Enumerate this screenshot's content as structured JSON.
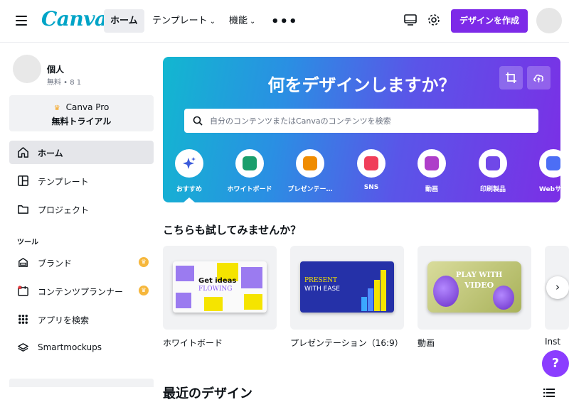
{
  "header": {
    "logo": "Canva",
    "nav": [
      "ホーム",
      "テンプレート",
      "機能"
    ],
    "create_button": "デザインを作成"
  },
  "sidebar": {
    "user": {
      "name": "個人",
      "meta": "無料 • 8 1"
    },
    "pro": {
      "title": "Canva Pro",
      "subtitle": "無料トライアル"
    },
    "items": [
      {
        "label": "ホーム",
        "icon": "home-icon",
        "active": true
      },
      {
        "label": "テンプレート",
        "icon": "template-icon"
      },
      {
        "label": "プロジェクト",
        "icon": "folder-icon"
      }
    ],
    "tools_label": "ツール",
    "tools": [
      {
        "label": "ブランド",
        "icon": "brand-icon",
        "pro": true
      },
      {
        "label": "コンテンツプランナー",
        "icon": "calendar-icon",
        "pro": true
      },
      {
        "label": "アプリを検索",
        "icon": "apps-grid-icon"
      },
      {
        "label": "Smartmockups",
        "icon": "layers-icon"
      }
    ]
  },
  "hero": {
    "title": "何をデザインしますか？",
    "search_placeholder": "自分のコンテンツまたはCanvaのコンテンツを検索",
    "categories": [
      {
        "label": "おすすめ",
        "icon": "sparkle-icon",
        "color": "#3b5bdb"
      },
      {
        "label": "ホワイトボード",
        "icon": "whiteboard-icon",
        "color": "#1a9e6b"
      },
      {
        "label": "プレゼンテー…",
        "icon": "presentation-icon",
        "color": "#f08c00"
      },
      {
        "label": "SNS",
        "icon": "heart-icon",
        "color": "#f03e5a"
      },
      {
        "label": "動画",
        "icon": "video-icon",
        "color": "#ae3ec9"
      },
      {
        "label": "印刷製品",
        "icon": "printer-icon",
        "color": "#7048e8"
      },
      {
        "label": "Webサ…",
        "icon": "cursor-icon",
        "color": "#4c6ef5"
      }
    ]
  },
  "try_section": {
    "title": "こちらも試してみませんか？",
    "cards": [
      {
        "label": "ホワイトボード",
        "thumb_line1": "Get ideas",
        "thumb_line2": "FLOWING"
      },
      {
        "label": "プレゼンテーション（16:9）",
        "thumb_line1": "PRESENT",
        "thumb_line2": "WITH EASE"
      },
      {
        "label": "動画",
        "thumb_line1": "PLAY WITH",
        "thumb_line2": "VIDEO"
      },
      {
        "label": "Inst"
      }
    ]
  },
  "recent": {
    "title": "最近のデザイン"
  },
  "help_label": "?"
}
